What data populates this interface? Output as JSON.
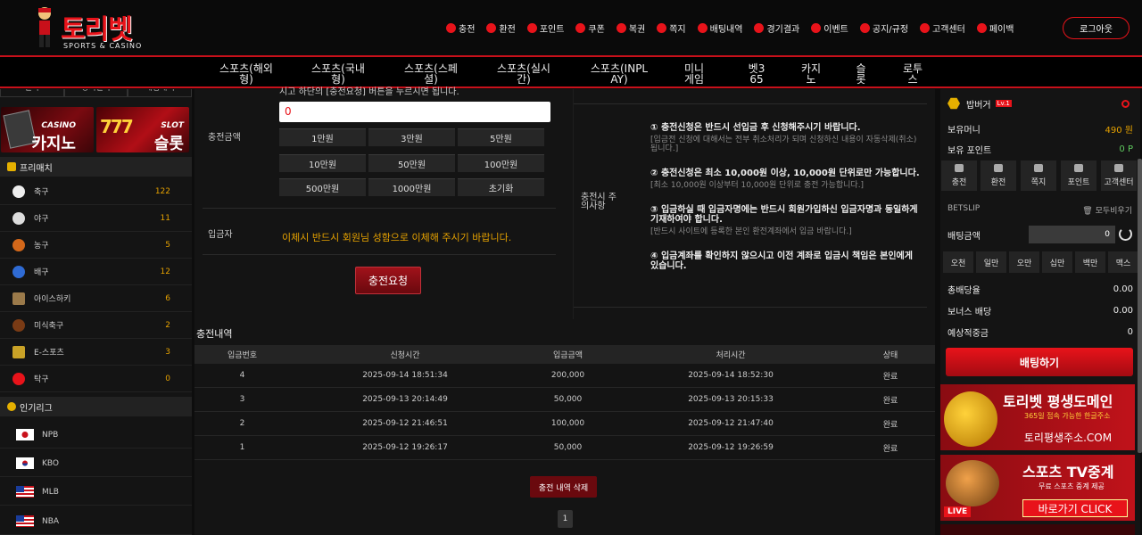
{
  "header": {
    "logo_text": "토리벳",
    "logo_sub": "SPORTS & CASINO",
    "nav": [
      "충전",
      "환전",
      "포인트",
      "쿠폰",
      "복권",
      "쪽지",
      "배팅내역",
      "경기결과",
      "이벤트",
      "공지/규정",
      "고객센터",
      "페이백"
    ],
    "logout": "로그아웃"
  },
  "game_tabs": [
    "스포츠(해외형)",
    "스포츠(국내형)",
    "스포츠(스페셜)",
    "스포츠(실시간)",
    "스포츠(INPLAY)",
    "미니게임",
    "벳365",
    "카지노",
    "슬롯",
    "로투스"
  ],
  "sidebar": {
    "old_tabs": [
      "결과",
      "경기결과",
      "배팅내역"
    ],
    "promo_casino": {
      "top": "CASINO",
      "main": "카지노"
    },
    "promo_slot": {
      "top": "SLOT",
      "main": "슬롯"
    },
    "prematch_title": "프리매치",
    "sports": [
      {
        "name": "축구",
        "count": "122"
      },
      {
        "name": "야구",
        "count": "11"
      },
      {
        "name": "농구",
        "count": "5"
      },
      {
        "name": "배구",
        "count": "12"
      },
      {
        "name": "아이스하키",
        "count": "6"
      },
      {
        "name": "미식축구",
        "count": "2"
      },
      {
        "name": "E-스포츠",
        "count": "3"
      },
      {
        "name": "탁구",
        "count": "0"
      }
    ],
    "league_title": "인기리그",
    "leagues": [
      "NPB",
      "KBO",
      "MLB",
      "NBA"
    ]
  },
  "form": {
    "note": "시고 하단의 [충전요청] 버튼을 누르시면 됩니다.",
    "note_highlight": "[충전요청]",
    "amount_label": "충전금액",
    "amount_value": "0",
    "amount_buttons": [
      "1만원",
      "3만원",
      "5만원",
      "10만원",
      "50만원",
      "100만원",
      "500만원",
      "1000만원",
      "초기화"
    ],
    "depositor_label": "입금자",
    "depositor_msg": "이체시 반드시 회원님 성함으로 이체해 주시기 바랍니다.",
    "request_btn": "충전요청"
  },
  "notice": {
    "side_label": "충전시 주의사항",
    "items": [
      {
        "h": "① 충전신청은 반드시 선입금 후 신청해주시기 바랍니다.",
        "s": "[입금전 신청에 대해서는 전부 취소처리가 되며 신청하신 내용이 자동삭제(취소)됩니다.]"
      },
      {
        "h": "② 충전신청은 최소 10,000원 이상, 10,000원 단위로만 가능합니다.",
        "s": "[최소 10,000원 이상부터 10,000원 단위로 충전 가능합니다.]"
      },
      {
        "h": "③ 입금하실 때 입금자명에는 반드시 회원가입하신 입금자명과 동일하게 기재하여야 합니다.",
        "s": "[반드시 사이트에 등록한 본인 환전계좌에서 입금 바랍니다.]"
      },
      {
        "h": "④ 입금계좌를 확인하지 않으시고 이전 계좌로 입금시 책임은 본인에게 있습니다.",
        "s": ""
      }
    ]
  },
  "history": {
    "title": "충전내역",
    "columns": [
      "입금번호",
      "신청시간",
      "입금금액",
      "처리시간",
      "상태"
    ],
    "rows": [
      [
        "4",
        "2025-09-14 18:51:34",
        "200,000",
        "2025-09-14 18:52:30",
        "완료"
      ],
      [
        "3",
        "2025-09-13 20:14:49",
        "50,000",
        "2025-09-13 20:15:33",
        "완료"
      ],
      [
        "2",
        "2025-09-12 21:46:51",
        "100,000",
        "2025-09-12 21:47:40",
        "완료"
      ],
      [
        "1",
        "2025-09-12 19:26:17",
        "50,000",
        "2025-09-12 19:26:59",
        "완료"
      ]
    ],
    "delete_btn": "충전 내역 삭제",
    "page": "1"
  },
  "right": {
    "username": "밥버거",
    "level": "Lv.1",
    "money_label": "보유머니",
    "money": "490 원",
    "point_label": "보유 포인트",
    "point": "0 P",
    "quick": [
      "충전",
      "환전",
      "쪽지",
      "포인트",
      "고객센터"
    ],
    "betslip": "BETSLIP",
    "delete_all": "모두비우기",
    "bet_amount_label": "배팅금액",
    "bet_amount": "0",
    "chips": [
      "오천",
      "일만",
      "오만",
      "십만",
      "백만",
      "맥스"
    ],
    "total_odds_label": "총배당율",
    "total_odds": "0.00",
    "bonus_label": "보너스 배당",
    "bonus": "0.00",
    "expected_label": "예상적중금",
    "expected": "0",
    "bet_btn": "배팅하기",
    "banner1": {
      "title": "토리벳 평생도메인",
      "sub": "365일 접속 가능한 한글주소",
      "url": "토리평생주소.COM"
    },
    "banner2": {
      "title": "스포츠 TV중계",
      "sub": "무료 스포츠 중계 제공",
      "cta": "바로가기 CLICK",
      "live": "LIVE"
    }
  },
  "colors": {
    "accent": "#e8131a",
    "gold": "#e5a100",
    "bg": "#0d0d0d"
  }
}
